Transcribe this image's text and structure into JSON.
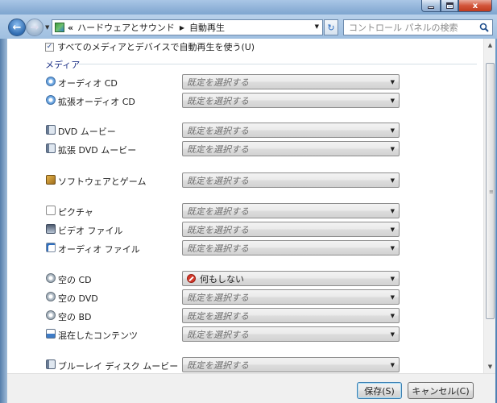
{
  "titlebar": {
    "buttons": {
      "minimize": "minimize",
      "maximize": "maximize",
      "close": "x"
    }
  },
  "nav": {
    "back_glyph": "←",
    "forward_glyph": "→",
    "breadcrumb_prefix": "«",
    "breadcrumb_parent": "ハードウェアとサウンド",
    "breadcrumb_sep": "▶",
    "breadcrumb_current": "自動再生",
    "refresh_glyph": "↻",
    "search_placeholder": "コントロール パネルの検索"
  },
  "main": {
    "autoplay_checkbox": {
      "label": "すべてのメディアとデバイスで自動再生を使う(U)",
      "checked": true
    },
    "group_title": "メディア",
    "rows": [
      {
        "label": "オーディオ CD",
        "icon": "audio-cd-icon",
        "value": "既定を選択する"
      },
      {
        "label": "拡張オーディオ CD",
        "icon": "enhanced-audio-cd-icon",
        "value": "既定を選択する"
      },
      {
        "label": "DVD ムービー",
        "icon": "dvd-movie-icon",
        "value": "既定を選択する"
      },
      {
        "label": "拡張 DVD ムービー",
        "icon": "enhanced-dvd-movie-icon",
        "value": "既定を選択する"
      },
      {
        "label": "ソフトウェアとゲーム",
        "icon": "software-games-icon",
        "value": "既定を選択する"
      },
      {
        "label": "ピクチャ",
        "icon": "pictures-icon",
        "value": "既定を選択する"
      },
      {
        "label": "ビデオ ファイル",
        "icon": "video-files-icon",
        "value": "既定を選択する"
      },
      {
        "label": "オーディオ ファイル",
        "icon": "audio-files-icon",
        "value": "既定を選択する"
      },
      {
        "label": "空の CD",
        "icon": "blank-cd-icon",
        "value": "何もしない"
      },
      {
        "label": "空の DVD",
        "icon": "blank-dvd-icon",
        "value": "既定を選択する"
      },
      {
        "label": "空の BD",
        "icon": "blank-bd-icon",
        "value": "既定を選択する"
      },
      {
        "label": "混在したコンテンツ",
        "icon": "mixed-content-icon",
        "value": "既定を選択する"
      },
      {
        "label": "ブルーレイ ディスク ムービー",
        "icon": "bluray-movie-icon",
        "value": "既定を選択する"
      }
    ]
  },
  "footer": {
    "save_label": "保存(S)",
    "cancel_label": "キャンセル(C)"
  },
  "colors": {
    "group_title": "#1e3287",
    "stop_icon": "#d43a2c"
  }
}
